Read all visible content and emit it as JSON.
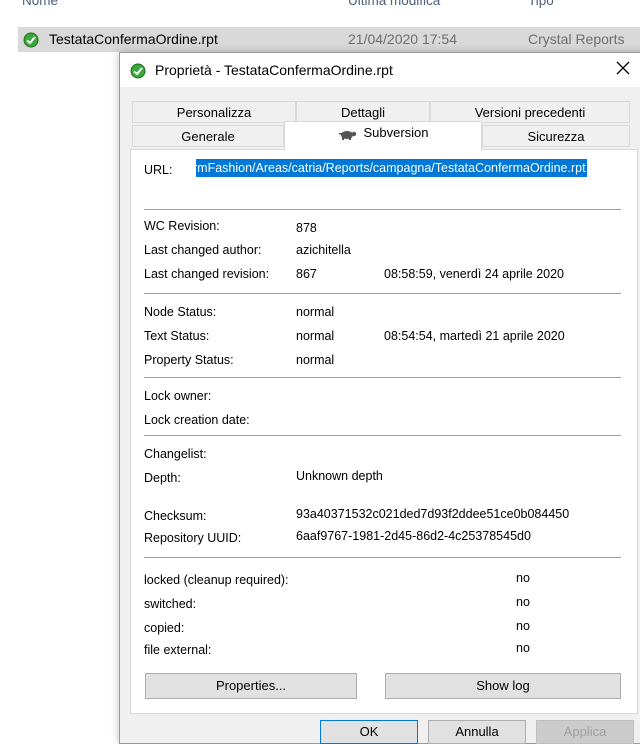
{
  "explorer": {
    "columns": [
      "Nome",
      "Ultima modifica",
      "Tipo"
    ],
    "file": {
      "name": "TestataConfermaOrdine.rpt",
      "date": "21/04/2020 17:54",
      "type": "Crystal Reports"
    }
  },
  "dialog": {
    "title": "Proprietà - TestataConfermaOrdine.rpt",
    "tabs_row1": [
      "Personalizza",
      "Dettagli",
      "Versioni precedenti"
    ],
    "tabs_row2": [
      "Generale",
      "Subversion",
      "Sicurezza"
    ],
    "active_tab": "Subversion",
    "url_label": "URL:",
    "url_value": "rmFashion/Areas/catria/Reports/campagna/TestataConfermaOrdine.rpt",
    "wc_revision": {
      "label": "WC Revision:",
      "value": "878"
    },
    "last_changed_author": {
      "label": "Last changed author:",
      "value": "azichitella"
    },
    "last_changed_revision": {
      "label": "Last changed revision:",
      "value": "867",
      "date": "08:58:59, venerdì 24 aprile 2020"
    },
    "node_status": {
      "label": "Node Status:",
      "value": "normal"
    },
    "text_status": {
      "label": "Text Status:",
      "value": "normal",
      "date": "08:54:54, martedì 21 aprile 2020"
    },
    "property_status": {
      "label": "Property Status:",
      "value": "normal"
    },
    "lock_owner": {
      "label": "Lock owner:",
      "value": ""
    },
    "lock_creation_date": {
      "label": "Lock creation date:",
      "value": ""
    },
    "changelist": {
      "label": "Changelist:",
      "value": ""
    },
    "depth": {
      "label": "Depth:",
      "value": "Unknown depth"
    },
    "checksum": {
      "label": "Checksum:",
      "value": "93a40371532c021ded7d93f2ddee51ce0b084450"
    },
    "repository_uuid": {
      "label": "Repository UUID:",
      "value": "6aaf9767-1981-2d45-86d2-4c25378545d0"
    },
    "flags": [
      {
        "label": "locked (cleanup required):",
        "value": "no"
      },
      {
        "label": "switched:",
        "value": "no"
      },
      {
        "label": "copied:",
        "value": "no"
      },
      {
        "label": "file external:",
        "value": "no"
      }
    ],
    "buttons": {
      "properties": "Properties...",
      "show_log": "Show log",
      "ok": "OK",
      "cancel": "Annulla",
      "apply": "Applica"
    }
  },
  "colors": {
    "selection": "#0078d7",
    "file_row_bg": "#d9d9d9",
    "dialog_bg": "#f0f0f0"
  },
  "icons": [
    "tortoisesvn-normal-overlay-icon",
    "tortoise-icon",
    "close-icon"
  ]
}
